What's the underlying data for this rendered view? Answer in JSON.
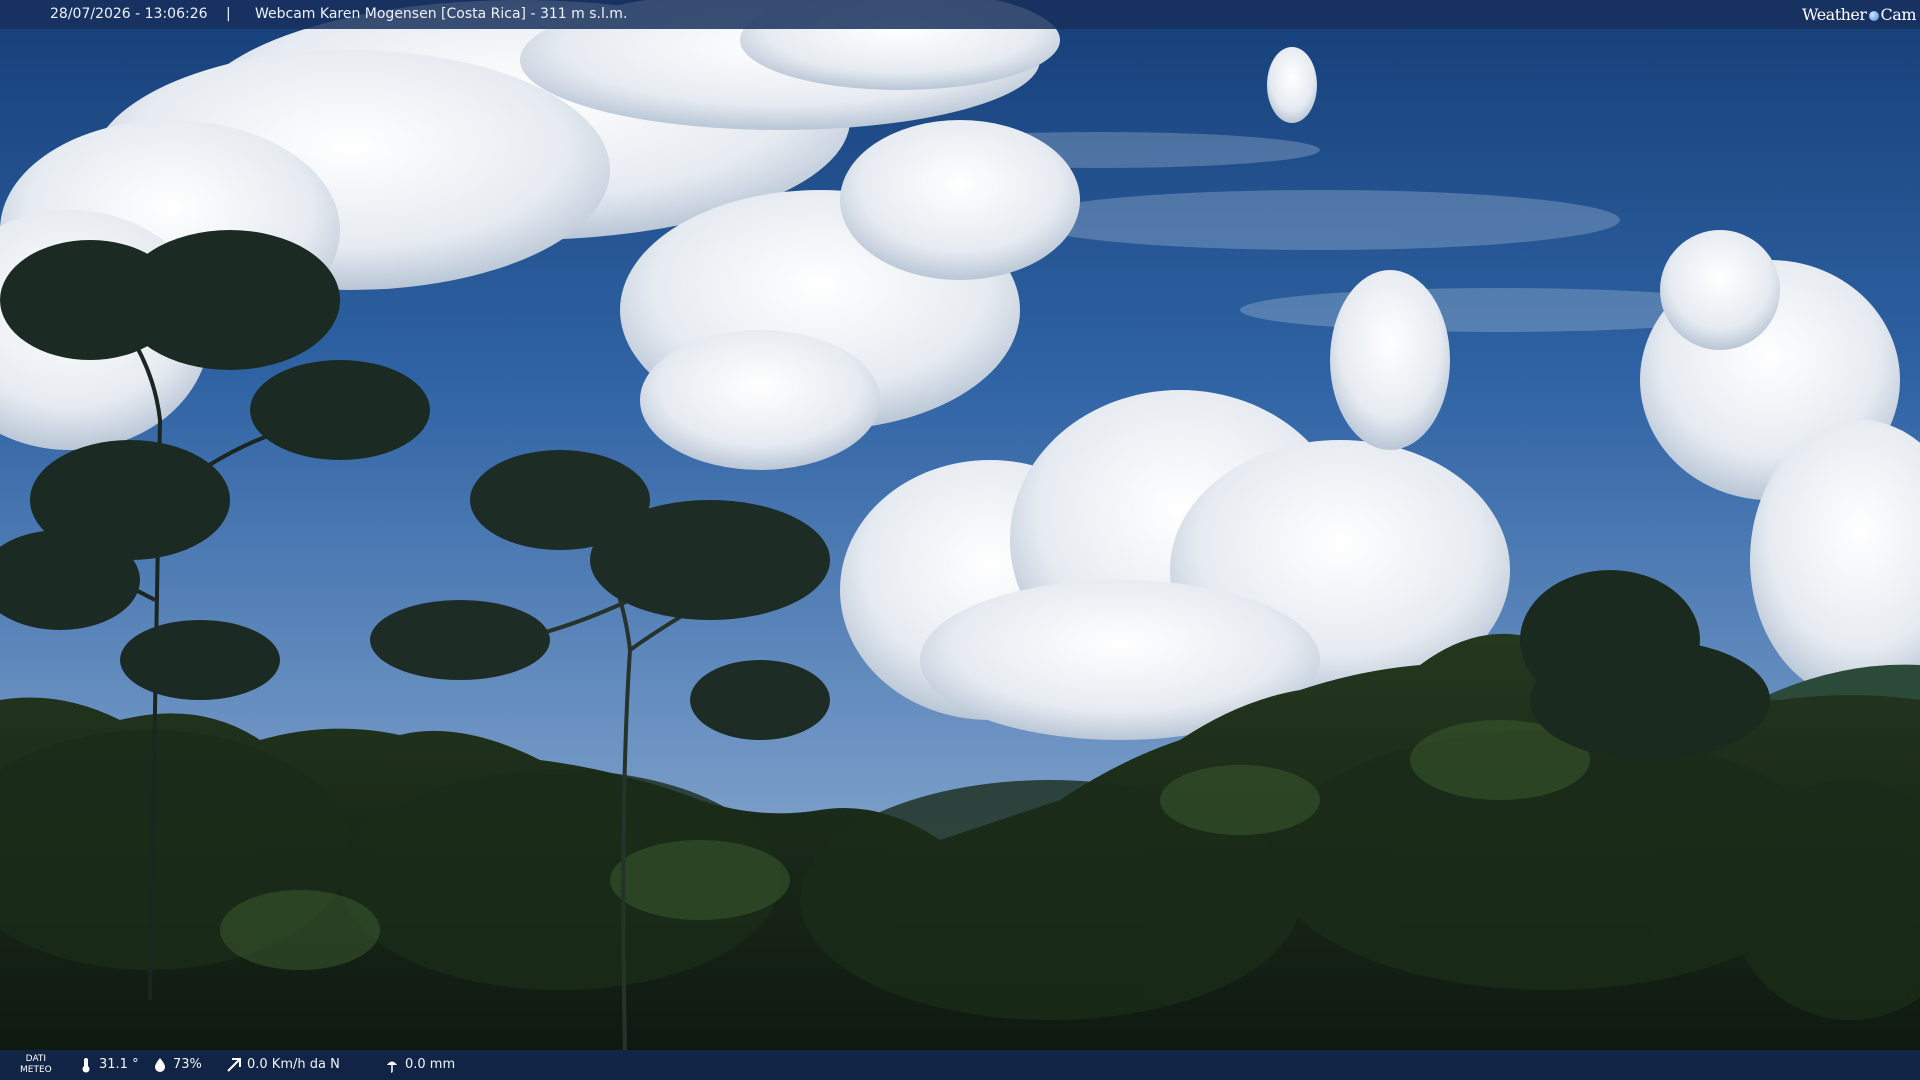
{
  "header": {
    "datetime": "28/07/2026 - 13:06:26",
    "separator": "|",
    "title": "Webcam Karen Mogensen [Costa Rica] - 311 m s.l.m.",
    "brand_left": "Weather",
    "brand_right": "Cam"
  },
  "footer": {
    "label_line1": "DATI",
    "label_line2": "METEO",
    "temperature": "31.1 °",
    "humidity": "73%",
    "wind": "0.0 Km/h da N",
    "rain": "0.0 mm",
    "icons": [
      "thermometer-icon",
      "humidity-icon",
      "wind-icon",
      "rain-icon"
    ]
  },
  "colors": {
    "sky_top": "#17447f",
    "sky_mid": "#3a6fb0",
    "sky_low": "#8fb0d2",
    "cloud": "#eef1f5",
    "foliage_dark": "#0e1a12",
    "foliage_mid": "#23381f"
  }
}
